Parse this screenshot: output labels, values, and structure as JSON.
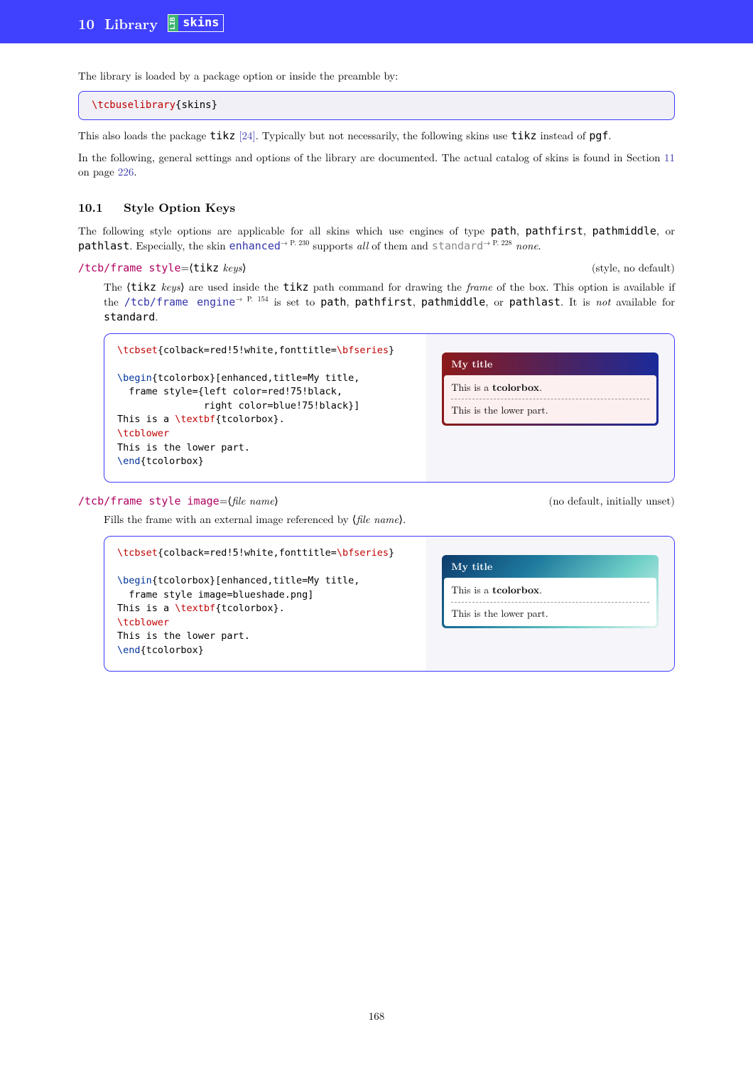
{
  "header": {
    "section_num": "10",
    "title": "Library",
    "lib_badge_left": "LIB",
    "lib_badge_right": "skins"
  },
  "intro": {
    "p1": "The library is loaded by a package option or inside the preamble by:",
    "code_cmd": "\\tcbuselibrary",
    "code_arg": "{skins}",
    "p2a": "This also loads the package ",
    "p2_tikz": "tikz",
    "p2_cite": " [24]",
    "p2b": ". Typically but not necessarily, the following skins use ",
    "p2c": " instead of ",
    "p2_pgf": "pgf",
    "p2d": ".",
    "p3a": "In the following, general settings and options of the library are documented. The actual catalog of skins is found in Section ",
    "p3_secref": "11",
    "p3b": " on page ",
    "p3_pageref": "226",
    "p3c": "."
  },
  "sub": {
    "num": "10.1",
    "title": "Style Option Keys",
    "p1a": "The following style options are applicable for all skins which use engines of type ",
    "engines": [
      "path",
      "pathfirst",
      "pathmiddle",
      "pathlast"
    ],
    "p1b": ". Especially, the skin ",
    "enhanced": "enhanced",
    "enh_sup": "→ P. 230",
    "p1c": " supports ",
    "p1_all": "all",
    "p1d": " of them and ",
    "standard": "standard",
    "std_sup": "→ P. 228",
    "p1_none": " none",
    "p1e": "."
  },
  "key1": {
    "name": "/tcb/frame style",
    "eq": "=",
    "arg_open": "⟨",
    "arg_tt": "tikz",
    "arg_it": " keys",
    "arg_close": "⟩",
    "type": "(style, no default)",
    "desc_a": "The ⟨",
    "desc_tikz": "tikz",
    "desc_keys": " keys",
    "desc_b": "⟩ are used inside the ",
    "desc_c": " path command for drawing the ",
    "desc_frame": "frame",
    "desc_d": " of the box. This option is available if the ",
    "frame_engine": "/tcb/frame engine",
    "fe_sup": "→ P. 154",
    "desc_e": " is set to ",
    "desc_f": ". It is ",
    "desc_not": "not",
    "desc_g": " available for ",
    "desc_std": "standard",
    "desc_h": "."
  },
  "ex1": {
    "code": {
      "l1a": "\\tcbset",
      "l1b": "{colback=red!5!white,fonttitle=",
      "l1c": "\\bfseries",
      "l1d": "}",
      "l2a": "\\begin",
      "l2b": "{tcolorbox}[enhanced,title=My title,",
      "l3": "  frame style={left color=red!75!black,",
      "l4": "               right color=blue!75!black}]",
      "l5a": "This is a ",
      "l5b": "\\textbf",
      "l5c": "{tcolorbox}.",
      "l6": "\\tcblower",
      "l7": "This is the lower part.",
      "l8a": "\\end",
      "l8b": "{tcolorbox}"
    },
    "out": {
      "title": "My title",
      "upper_a": "This is a ",
      "upper_b": "tcolorbox",
      "upper_c": ".",
      "lower": "This is the lower part."
    }
  },
  "key2": {
    "name": "/tcb/frame style image",
    "eq": "=",
    "arg_open": "⟨",
    "arg_it": "file name",
    "arg_close": "⟩",
    "type": "(no default, initially unset)",
    "desc_a": "Fills the frame with an external image referenced by ⟨",
    "desc_fn": "file name",
    "desc_b": "⟩."
  },
  "ex2": {
    "code": {
      "l1a": "\\tcbset",
      "l1b": "{colback=red!5!white,fonttitle=",
      "l1c": "\\bfseries",
      "l1d": "}",
      "l2a": "\\begin",
      "l2b": "{tcolorbox}[enhanced,title=My title,",
      "l3": "  frame style image=blueshade.png]",
      "l5a": "This is a ",
      "l5b": "\\textbf",
      "l5c": "{tcolorbox}.",
      "l6": "\\tcblower",
      "l7": "This is the lower part.",
      "l8a": "\\end",
      "l8b": "{tcolorbox}"
    },
    "out": {
      "title": "My title",
      "upper_a": "This is a ",
      "upper_b": "tcolorbox",
      "upper_c": ".",
      "lower": "This is the lower part."
    }
  },
  "page_number": "168"
}
